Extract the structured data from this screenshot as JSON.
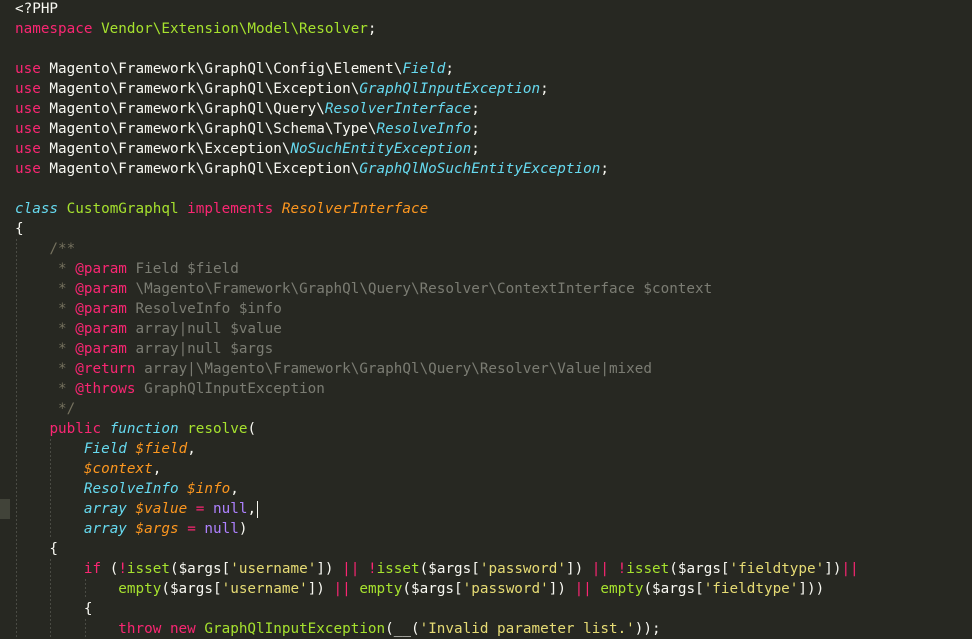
{
  "editor": {
    "theme": "monokai",
    "colors": {
      "background": "#272822",
      "plain": "#f8f8f2",
      "keyword": "#f92672",
      "type": "#a6e22e",
      "italic_class": "#66d9ef",
      "parameter": "#fd971f",
      "string": "#e6db74",
      "constant": "#ae81ff",
      "comment": "#75715e"
    },
    "active_line": 25,
    "lines": [
      {
        "indent": 0,
        "tokens": [
          [
            "plain",
            "<?PHP"
          ]
        ]
      },
      {
        "indent": 0,
        "tokens": [
          [
            "kw",
            "namespace"
          ],
          [
            "plain",
            " "
          ],
          [
            "type",
            "Vendor\\Extension\\Model\\Resolver"
          ],
          [
            "plain",
            ";"
          ]
        ]
      },
      {
        "indent": 0,
        "tokens": []
      },
      {
        "indent": 0,
        "tokens": [
          [
            "kw",
            "use"
          ],
          [
            "plain",
            " Magento\\Framework\\GraphQl\\Config\\Element\\"
          ],
          [
            "ital",
            "Field"
          ],
          [
            "plain",
            ";"
          ]
        ]
      },
      {
        "indent": 0,
        "tokens": [
          [
            "kw",
            "use"
          ],
          [
            "plain",
            " Magento\\Framework\\GraphQl\\Exception\\"
          ],
          [
            "ital",
            "GraphQlInputException"
          ],
          [
            "plain",
            ";"
          ]
        ]
      },
      {
        "indent": 0,
        "tokens": [
          [
            "kw",
            "use"
          ],
          [
            "plain",
            " Magento\\Framework\\GraphQl\\Query\\"
          ],
          [
            "ital",
            "ResolverInterface"
          ],
          [
            "plain",
            ";"
          ]
        ]
      },
      {
        "indent": 0,
        "tokens": [
          [
            "kw",
            "use"
          ],
          [
            "plain",
            " Magento\\Framework\\GraphQl\\Schema\\Type\\"
          ],
          [
            "ital",
            "ResolveInfo"
          ],
          [
            "plain",
            ";"
          ]
        ]
      },
      {
        "indent": 0,
        "tokens": [
          [
            "kw",
            "use"
          ],
          [
            "plain",
            " Magento\\Framework\\Exception\\"
          ],
          [
            "ital",
            "NoSuchEntityException"
          ],
          [
            "plain",
            ";"
          ]
        ]
      },
      {
        "indent": 0,
        "tokens": [
          [
            "kw",
            "use"
          ],
          [
            "plain",
            " Magento\\Framework\\GraphQl\\Exception\\"
          ],
          [
            "ital",
            "GraphQlNoSuchEntityException"
          ],
          [
            "plain",
            ";"
          ]
        ]
      },
      {
        "indent": 0,
        "tokens": []
      },
      {
        "indent": 0,
        "tokens": [
          [
            "ital",
            "class"
          ],
          [
            "plain",
            " "
          ],
          [
            "type",
            "CustomGraphql"
          ],
          [
            "plain",
            " "
          ],
          [
            "kw",
            "implements"
          ],
          [
            "plain",
            " "
          ],
          [
            "param",
            "ResolverInterface"
          ]
        ]
      },
      {
        "indent": 0,
        "tokens": [
          [
            "plain",
            "{"
          ]
        ]
      },
      {
        "indent": 1,
        "tokens": [
          [
            "comment",
            "    /**"
          ]
        ]
      },
      {
        "indent": 1,
        "tokens": [
          [
            "comment",
            "     * "
          ],
          [
            "kw",
            "@param"
          ],
          [
            "ctext",
            " Field $field"
          ]
        ]
      },
      {
        "indent": 1,
        "tokens": [
          [
            "comment",
            "     * "
          ],
          [
            "kw",
            "@param"
          ],
          [
            "ctext",
            " \\Magento\\Framework\\GraphQl\\Query\\Resolver\\ContextInterface $context"
          ]
        ]
      },
      {
        "indent": 1,
        "tokens": [
          [
            "comment",
            "     * "
          ],
          [
            "kw",
            "@param"
          ],
          [
            "ctext",
            " ResolveInfo $info"
          ]
        ]
      },
      {
        "indent": 1,
        "tokens": [
          [
            "comment",
            "     * "
          ],
          [
            "kw",
            "@param"
          ],
          [
            "ctext",
            " array|null $value"
          ]
        ]
      },
      {
        "indent": 1,
        "tokens": [
          [
            "comment",
            "     * "
          ],
          [
            "kw",
            "@param"
          ],
          [
            "ctext",
            " array|null $args"
          ]
        ]
      },
      {
        "indent": 1,
        "tokens": [
          [
            "comment",
            "     * "
          ],
          [
            "kw",
            "@return"
          ],
          [
            "ctext",
            " array|\\Magento\\Framework\\GraphQl\\Query\\Resolver\\Value|mixed"
          ]
        ]
      },
      {
        "indent": 1,
        "tokens": [
          [
            "comment",
            "     * "
          ],
          [
            "kw",
            "@throws"
          ],
          [
            "ctext",
            " GraphQlInputException"
          ]
        ]
      },
      {
        "indent": 1,
        "tokens": [
          [
            "comment",
            "     */"
          ]
        ]
      },
      {
        "indent": 1,
        "tokens": [
          [
            "plain",
            "    "
          ],
          [
            "kw",
            "public"
          ],
          [
            "plain",
            " "
          ],
          [
            "ital",
            "function"
          ],
          [
            "plain",
            " "
          ],
          [
            "fn",
            "resolve"
          ],
          [
            "plain",
            "("
          ]
        ]
      },
      {
        "indent": 2,
        "tokens": [
          [
            "plain",
            "        "
          ],
          [
            "ital",
            "Field"
          ],
          [
            "plain",
            " "
          ],
          [
            "param",
            "$field"
          ],
          [
            "plain",
            ","
          ]
        ]
      },
      {
        "indent": 2,
        "tokens": [
          [
            "plain",
            "        "
          ],
          [
            "param",
            "$context"
          ],
          [
            "plain",
            ","
          ]
        ]
      },
      {
        "indent": 2,
        "tokens": [
          [
            "plain",
            "        "
          ],
          [
            "ital",
            "ResolveInfo"
          ],
          [
            "plain",
            " "
          ],
          [
            "param",
            "$info"
          ],
          [
            "plain",
            ","
          ]
        ]
      },
      {
        "indent": 2,
        "caret": true,
        "tokens": [
          [
            "plain",
            "        "
          ],
          [
            "ital",
            "array"
          ],
          [
            "plain",
            " "
          ],
          [
            "param",
            "$value"
          ],
          [
            "plain",
            " "
          ],
          [
            "kw",
            "="
          ],
          [
            "plain",
            " "
          ],
          [
            "const",
            "null"
          ],
          [
            "plain",
            ","
          ]
        ]
      },
      {
        "indent": 2,
        "tokens": [
          [
            "plain",
            "        "
          ],
          [
            "ital",
            "array"
          ],
          [
            "plain",
            " "
          ],
          [
            "param",
            "$args"
          ],
          [
            "plain",
            " "
          ],
          [
            "kw",
            "="
          ],
          [
            "plain",
            " "
          ],
          [
            "const",
            "null"
          ],
          [
            "plain",
            ")"
          ]
        ]
      },
      {
        "indent": 1,
        "tokens": [
          [
            "plain",
            "    {"
          ]
        ]
      },
      {
        "indent": 2,
        "tokens": [
          [
            "plain",
            "        "
          ],
          [
            "kw",
            "if"
          ],
          [
            "plain",
            " ("
          ],
          [
            "kw",
            "!"
          ],
          [
            "fn",
            "isset"
          ],
          [
            "plain",
            "($args["
          ],
          [
            "str",
            "'username'"
          ],
          [
            "plain",
            "]) "
          ],
          [
            "kw",
            "||"
          ],
          [
            "plain",
            " "
          ],
          [
            "kw",
            "!"
          ],
          [
            "fn",
            "isset"
          ],
          [
            "plain",
            "($args["
          ],
          [
            "str",
            "'password'"
          ],
          [
            "plain",
            "]) "
          ],
          [
            "kw",
            "||"
          ],
          [
            "plain",
            " "
          ],
          [
            "kw",
            "!"
          ],
          [
            "fn",
            "isset"
          ],
          [
            "plain",
            "($args["
          ],
          [
            "str",
            "'fieldtype'"
          ],
          [
            "plain",
            "])"
          ],
          [
            "kw",
            "||"
          ]
        ]
      },
      {
        "indent": 3,
        "tokens": [
          [
            "plain",
            "            "
          ],
          [
            "fn",
            "empty"
          ],
          [
            "plain",
            "($args["
          ],
          [
            "str",
            "'username'"
          ],
          [
            "plain",
            "]) "
          ],
          [
            "kw",
            "||"
          ],
          [
            "plain",
            " "
          ],
          [
            "fn",
            "empty"
          ],
          [
            "plain",
            "($args["
          ],
          [
            "str",
            "'password'"
          ],
          [
            "plain",
            "]) "
          ],
          [
            "kw",
            "||"
          ],
          [
            "plain",
            " "
          ],
          [
            "fn",
            "empty"
          ],
          [
            "plain",
            "($args["
          ],
          [
            "str",
            "'fieldtype'"
          ],
          [
            "plain",
            "]))"
          ]
        ]
      },
      {
        "indent": 2,
        "tokens": [
          [
            "plain",
            "        {"
          ]
        ]
      },
      {
        "indent": 3,
        "tokens": [
          [
            "plain",
            "            "
          ],
          [
            "kw",
            "throw"
          ],
          [
            "plain",
            " "
          ],
          [
            "kw",
            "new"
          ],
          [
            "plain",
            " "
          ],
          [
            "type",
            "GraphQlInputException"
          ],
          [
            "plain",
            "(__("
          ],
          [
            "str",
            "'Invalid parameter list.'"
          ],
          [
            "plain",
            "));"
          ]
        ]
      }
    ]
  }
}
